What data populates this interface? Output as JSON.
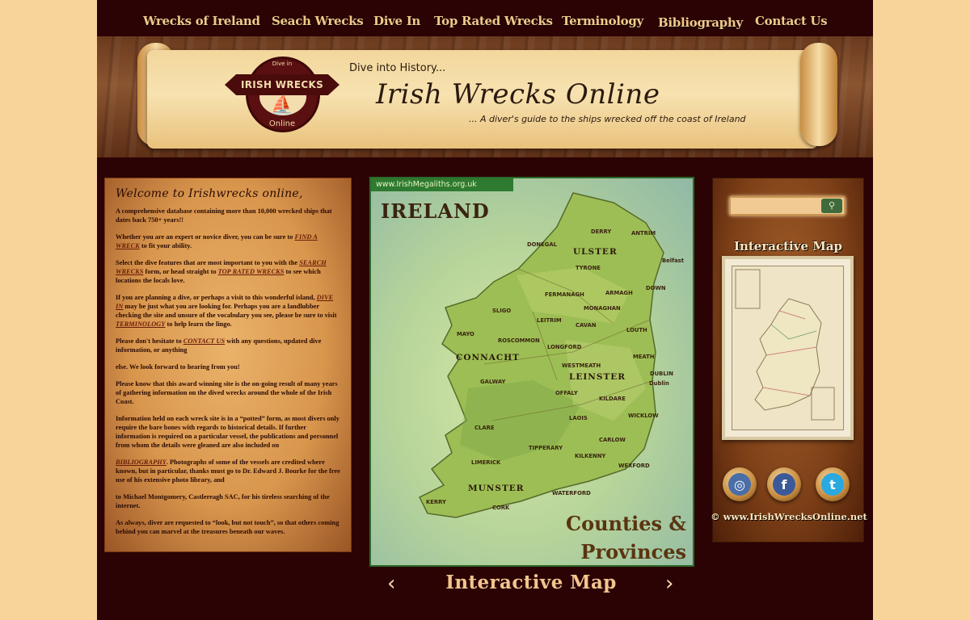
{
  "nav": {
    "items": [
      {
        "label": "Wrecks of Ireland"
      },
      {
        "label": "Seach Wrecks"
      },
      {
        "label": "Dive In"
      },
      {
        "label": "Top Rated Wrecks"
      },
      {
        "label": "Terminology"
      },
      {
        "label": "Bibliography"
      },
      {
        "label": "Contact Us"
      }
    ]
  },
  "banner": {
    "logo_top": "Dive in",
    "logo_main": "IRISH WRECKS",
    "logo_bottom": "Online",
    "tagline": "Dive into History...",
    "title": "Irish Wrecks Online",
    "subtitle": "... A diver's guide to the ships wrecked off the coast of Ireland"
  },
  "welcome": {
    "heading": "Welcome to Irishwrecks online,",
    "p1": "A comprehensive database containing more than 10,000 wrecked ships that dates back 750+ years!!",
    "p2_pre": "Whether you are an expert or novice diver, you can be sure to ",
    "p2_link": "FIND A WRECK",
    "p2_post": " to fit your ability.",
    "p3_pre": "Select the dive features that are most important to you with the ",
    "p3_link1": "SEARCH WRECKS",
    "p3_mid": " form, or head straight to ",
    "p3_link2": "TOP RATED WRECKS",
    "p3_post": " to see which locations the locals love.",
    "p4_pre": "If you are planning a dive, or perhaps a visit to this wonderful island, ",
    "p4_link1": "DIVE IN",
    "p4_mid": " may be just what you are looking for. Perhaps you are a landlubber checking the site and unsure of the vocabulary you see, please be sure to visit ",
    "p4_link2": "TERMINOLOGY",
    "p4_post": " to help learn the lingo.",
    "p5_pre": "Please don't hesitate to ",
    "p5_link": "CONTACT US",
    "p5_post": " with any questions, updated dive information, or anything",
    "p6": "else. We look forward to hearing from you!",
    "p7": "Please know that this award winning site is the on-going result of many years of gathering information on the dived wrecks around the whole of the Irish Coast.",
    "p8": "Information held on each wreck site is in a “potted” form, as most divers only require the bare bones with regards to historical details.  If further information is required on a particular vessel, the publications and personnel from whom the details were gleaned are also included on",
    "p9_link": "BIBLIOGRAPHY",
    "p9_post": ".  Photographs of some of the vessels are credited where known, but in particular, thanks must go to Dr. Edward J. Bourke for the free use of his extensive photo library, and",
    "p10": " to Michael Montgomery, Castlereagh SAC, for his tireless searching of the internet.",
    "p11": "As always, diver are requested to “look, but not touch”, so that others coming behind you can marvel at the treasures beneath our waves."
  },
  "map": {
    "url_tag": "www.IrishMegaliths.org.uk",
    "country": "IRELAND",
    "caption_line1": "Counties &",
    "caption_line2": "Provinces",
    "provinces": [
      "ULSTER",
      "CONNACHT",
      "LEINSTER",
      "MUNSTER"
    ],
    "counties": [
      "DERRY",
      "ANTRIM",
      "DONEGAL",
      "TYRONE",
      "Belfast",
      "FERMANAGH",
      "ARMAGH",
      "DOWN",
      "MONAGHAN",
      "SLIGO",
      "LEITRIM",
      "CAVAN",
      "LOUTH",
      "MAYO",
      "ROSCOMMON",
      "LONGFORD",
      "MEATH",
      "WESTMEATH",
      "DUBLIN",
      "Dublin",
      "GALWAY",
      "OFFALY",
      "KILDARE",
      "LAOIS",
      "WICKLOW",
      "CLARE",
      "CARLOW",
      "TIPPERARY",
      "KILKENNY",
      "LIMERICK",
      "WEXFORD",
      "KERRY",
      "CORK",
      "WATERFORD"
    ],
    "nav_title": "Interactive Map",
    "prev_arrow": "‹",
    "next_arrow": "›"
  },
  "sidebar": {
    "search_placeholder": "",
    "search_button_icon": "search-icon",
    "map_title": "Interactive Map",
    "social": [
      {
        "name": "instagram",
        "glyph": "◎",
        "color": "#4a6ea8"
      },
      {
        "name": "facebook",
        "glyph": "f",
        "color": "#3b5998"
      },
      {
        "name": "twitter",
        "glyph": "t",
        "color": "#2aa9e0"
      }
    ],
    "copyright": "© www.IrishWrecksOnline.net"
  },
  "colors": {
    "page_bg": "#f9d49a",
    "frame_bg": "#2b0304",
    "nav_text": "#f0c98a",
    "map_green": "#2e7a30"
  }
}
